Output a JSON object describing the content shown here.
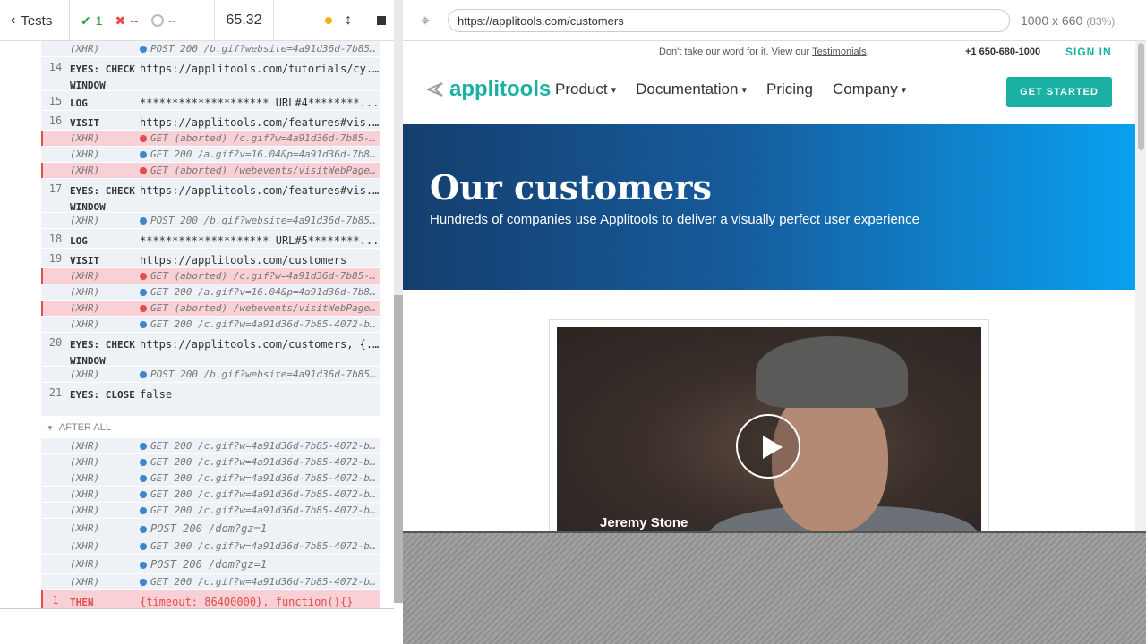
{
  "topbar": {
    "back_label": "Tests",
    "passed": "1",
    "failed": "--",
    "pending": "--",
    "duration": "65.32",
    "url": "https://applitools.com/customers",
    "viewport": "1000 x 660",
    "zoom": "(83%)"
  },
  "log": {
    "rows": [
      {
        "num": "",
        "name": "(XHR)",
        "msg": "POST 200 /b.gif?website=4a91d36d-7b85-40...",
        "type": "xhr",
        "dot": "blue",
        "alert": false
      },
      {
        "num": "14",
        "name": "EYES: CHECK WINDOW",
        "msg": "https://applitools.com/tutorials/cy...",
        "type": "cmd",
        "alert": false
      },
      {
        "num": "15",
        "name": "LOG",
        "msg": "******************** URL#4********...",
        "type": "cmd",
        "alert": false
      },
      {
        "num": "16",
        "name": "VISIT",
        "msg": "https://applitools.com/features#vis...",
        "type": "cmd",
        "alert": false
      },
      {
        "num": "",
        "name": "(XHR)",
        "msg": "GET (aborted) /c.gif?w=4a91d36d-7b85-407...",
        "type": "xhr",
        "dot": "red",
        "alert": true
      },
      {
        "num": "",
        "name": "(XHR)",
        "msg": "GET 200 /a.gif?v=16.04&p=4a91d36d-7b85-4...",
        "type": "xhr",
        "dot": "blue",
        "alert": false
      },
      {
        "num": "",
        "name": "(XHR)",
        "msg": "GET (aborted) /webevents/visitWebPage?_m...",
        "type": "xhr",
        "dot": "red",
        "alert": true
      },
      {
        "num": "17",
        "name": "EYES: CHECK WINDOW",
        "msg": "https://applitools.com/features#vis...",
        "type": "cmd",
        "alert": false
      },
      {
        "num": "",
        "name": "(XHR)",
        "msg": "POST 200 /b.gif?website=4a91d36d-7b85-40...",
        "type": "xhr",
        "dot": "blue",
        "alert": false
      },
      {
        "num": "18",
        "name": "LOG",
        "msg": "******************** URL#5********...",
        "type": "cmd",
        "alert": false
      },
      {
        "num": "19",
        "name": "VISIT",
        "msg": "https://applitools.com/customers",
        "type": "cmd",
        "alert": false
      },
      {
        "num": "",
        "name": "(XHR)",
        "msg": "GET (aborted) /c.gif?w=4a91d36d-7b85-407...",
        "type": "xhr",
        "dot": "red",
        "alert": true
      },
      {
        "num": "",
        "name": "(XHR)",
        "msg": "GET 200 /a.gif?v=16.04&p=4a91d36d-7b85-4...",
        "type": "xhr",
        "dot": "blue",
        "alert": false
      },
      {
        "num": "",
        "name": "(XHR)",
        "msg": "GET (aborted) /webevents/visitWebPage?_m...",
        "type": "xhr",
        "dot": "red",
        "alert": true
      },
      {
        "num": "",
        "name": "(XHR)",
        "msg": "GET 200 /c.gif?w=4a91d36d-7b85-4072-bd95...",
        "type": "xhr",
        "dot": "blue",
        "alert": false
      },
      {
        "num": "20",
        "name": "EYES: CHECK WINDOW",
        "msg": "https://applitools.com/customers, {...",
        "type": "cmd",
        "alert": false
      },
      {
        "num": "",
        "name": "(XHR)",
        "msg": "POST 200 /b.gif?website=4a91d36d-7b85-40...",
        "type": "xhr",
        "dot": "blue",
        "alert": false
      },
      {
        "num": "21",
        "name": "EYES: CLOSE",
        "msg": "false",
        "type": "cmd",
        "alert": false
      }
    ],
    "after_all_label": "AFTER ALL",
    "after_rows": [
      {
        "name": "(XHR)",
        "msg": "GET 200 /c.gif?w=4a91d36d-7b85-4072-bd95...",
        "size": "small"
      },
      {
        "name": "(XHR)",
        "msg": "GET 200 /c.gif?w=4a91d36d-7b85-4072-bd95...",
        "size": "small"
      },
      {
        "name": "(XHR)",
        "msg": "GET 200 /c.gif?w=4a91d36d-7b85-4072-bd95...",
        "size": "small"
      },
      {
        "name": "(XHR)",
        "msg": "GET 200 /c.gif?w=4a91d36d-7b85-4072-bd95...",
        "size": "small"
      },
      {
        "name": "(XHR)",
        "msg": "GET 200 /c.gif?w=4a91d36d-7b85-4072-bd95...",
        "size": "small"
      },
      {
        "name": "(XHR)",
        "msg": "POST 200 /dom?gz=1",
        "size": "large"
      },
      {
        "name": "(XHR)",
        "msg": "GET 200 /c.gif?w=4a91d36d-7b85-4072-bd95...",
        "size": "small"
      },
      {
        "name": "(XHR)",
        "msg": "POST 200 /dom?gz=1",
        "size": "large"
      },
      {
        "name": "(XHR)",
        "msg": "GET 200 /c.gif?w=4a91d36d-7b85-4072-bd95...",
        "size": "small"
      }
    ],
    "then_row": {
      "num": "1",
      "name": "THEN",
      "msg": "{timeout: 86400000}, function(){}"
    }
  },
  "app": {
    "util_text": "Don't take our word for it. View our",
    "util_link": "Testimonials",
    "util_period": ".",
    "phone": "+1 650-680-1000",
    "sign_in": "SIGN IN",
    "logo_text": "applitools",
    "menu": [
      "Product",
      "Documentation",
      "Pricing",
      "Company"
    ],
    "cta": "GET STARTED",
    "hero_title": "Our customers",
    "hero_subtitle": "Hundreds of companies use Applitools to deliver a visually perfect user experience",
    "video_caption": "Jeremy Stone"
  },
  "colors": {
    "accent": "#1ab1a4",
    "pass": "#2b9b43",
    "fail": "#e24d4d",
    "hero_start": "#153e6e",
    "hero_end": "#0aa0f0"
  }
}
